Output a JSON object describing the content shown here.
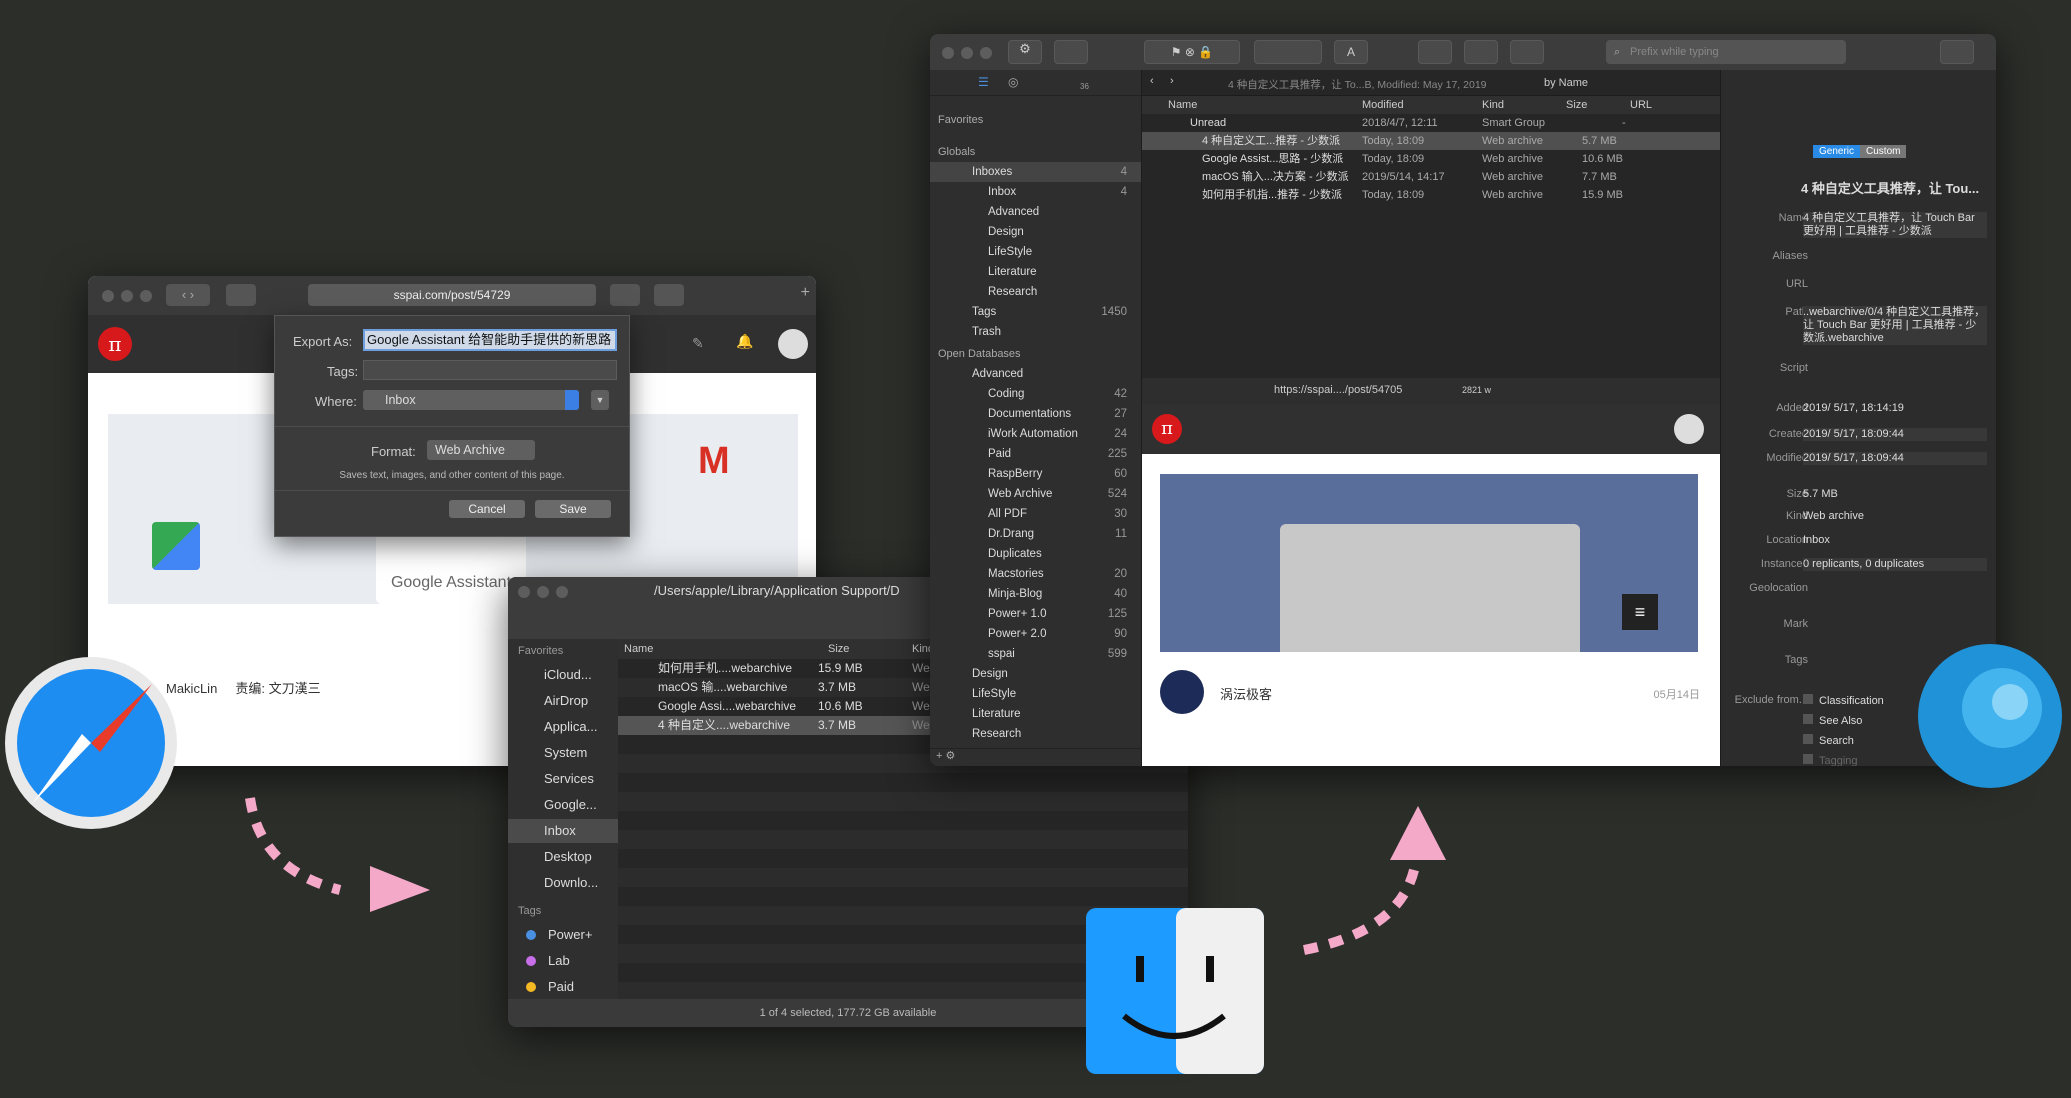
{
  "safari": {
    "url": "sspai.com/post/54729",
    "author": "MakicLin",
    "editor": "责编: 文刀漢三",
    "card": "Google Assistant"
  },
  "export": {
    "export_label": "Export As:",
    "export_value": "Google Assistant 给智能助手提供的新思路",
    "tags_label": "Tags:",
    "where_label": "Where:",
    "where_value": "Inbox",
    "format_label": "Format:",
    "format_value": "Web Archive",
    "desc": "Saves text, images, and other content of this page.",
    "cancel": "Cancel",
    "save": "Save"
  },
  "finder": {
    "path": "/Users/apple/Library/Application Support/D",
    "favorites_header": "Favorites",
    "favorites": [
      "iCloud...",
      "AirDrop",
      "Applica...",
      "System",
      "Services",
      "Google...",
      "Inbox",
      "Desktop",
      "Downlo..."
    ],
    "tags_header": "Tags",
    "tags": [
      {
        "name": "Power+",
        "color": "#4a90e2"
      },
      {
        "name": "Lab",
        "color": "#c86ee8"
      },
      {
        "name": "Paid",
        "color": "#f5b923"
      }
    ],
    "cols": {
      "name": "Name",
      "size": "Size",
      "kind": "Kind"
    },
    "files": [
      {
        "name": "如何用手机....webarchive",
        "size": "15.9 MB",
        "kind": "Web"
      },
      {
        "name": "macOS 输....webarchive",
        "size": "3.7 MB",
        "kind": "Web"
      },
      {
        "name": "Google Assi....webarchive",
        "size": "10.6 MB",
        "kind": "Web"
      },
      {
        "name": "4 种自定义....webarchive",
        "size": "3.7 MB",
        "kind": "Web"
      }
    ],
    "status": "1 of 4 selected, 177.72 GB available"
  },
  "devon": {
    "search_placeholder": "Prefix while typing",
    "crumb": "4 种自定义工具推荐，让 To...B, Modified: May 17, 2019",
    "sort": "by Name",
    "badge": "36",
    "sidebar": {
      "favorites": "Favorites",
      "globals": "Globals",
      "open_db": "Open Databases",
      "globals_items": [
        {
          "t": "Inboxes",
          "c": "4",
          "dot": true
        },
        {
          "t": "Inbox",
          "c": "4"
        },
        {
          "t": "Advanced",
          "c": ""
        },
        {
          "t": "Design",
          "c": ""
        },
        {
          "t": "LifeStyle",
          "c": ""
        },
        {
          "t": "Literature",
          "c": ""
        },
        {
          "t": "Research",
          "c": ""
        },
        {
          "t": "Tags",
          "c": "1450"
        },
        {
          "t": "Trash",
          "c": ""
        }
      ],
      "db_items": [
        {
          "t": "Advanced",
          "c": ""
        },
        {
          "t": "Coding",
          "c": "42"
        },
        {
          "t": "Documentations",
          "c": "27"
        },
        {
          "t": "iWork Automation",
          "c": "24"
        },
        {
          "t": "Paid",
          "c": "225"
        },
        {
          "t": "RaspBerry",
          "c": "60"
        },
        {
          "t": "Web Archive",
          "c": "524"
        },
        {
          "t": "All PDF",
          "c": "30"
        },
        {
          "t": "Dr.Drang",
          "c": "11"
        },
        {
          "t": "Duplicates",
          "c": ""
        },
        {
          "t": "Macstories",
          "c": "20"
        },
        {
          "t": "Minja-Blog",
          "c": "40"
        },
        {
          "t": "Power+ 1.0",
          "c": "125"
        },
        {
          "t": "Power+ 2.0",
          "c": "90"
        },
        {
          "t": "sspai",
          "c": "599"
        },
        {
          "t": "Design",
          "c": ""
        },
        {
          "t": "LifeStyle",
          "c": ""
        },
        {
          "t": "Literature",
          "c": ""
        },
        {
          "t": "Research",
          "c": ""
        }
      ]
    },
    "cols": {
      "name": "Name",
      "modified": "Modified",
      "kind": "Kind",
      "size": "Size",
      "url": "URL"
    },
    "group": {
      "name": "Unread",
      "modified": "2018/4/7, 12:11",
      "kind": "Smart Group",
      "size": "-"
    },
    "records": [
      {
        "name": "4 种自定义工...推荐 - 少数派",
        "modified": "Today, 18:09",
        "kind": "Web archive",
        "size": "5.7 MB"
      },
      {
        "name": "Google Assist...思路 - 少数派",
        "modified": "Today, 18:09",
        "kind": "Web archive",
        "size": "10.6 MB"
      },
      {
        "name": "macOS 输入...决方案 - 少数派",
        "modified": "2019/5/14, 14:17",
        "kind": "Web archive",
        "size": "7.7 MB"
      },
      {
        "name": "如何用手机指...推荐 - 少数派",
        "modified": "Today, 18:09",
        "kind": "Web archive",
        "size": "15.9 MB"
      }
    ],
    "viewer": {
      "url": "https://sspai..../post/54705",
      "words": "2821 w",
      "author": "涡沄极客",
      "date": "05月14日"
    },
    "inspector": {
      "tabs": [
        "Generic",
        "Custom"
      ],
      "title": "4 种自定义工具推荐，让 Tou...",
      "name_label": "Name",
      "name": "4 种自定义工具推荐，让 Touch Bar 更好用 | 工具推荐 - 少数派",
      "aliases": "Aliases",
      "url": "URL",
      "path_label": "Path",
      "path": "..webarchive/0/4 种自定义工具推荐，让 Touch Bar 更好用 | 工具推荐 - 少数派.webarchive",
      "script": "Script",
      "added_label": "Added",
      "added": "2019/  5/17, 18:14:19",
      "created_label": "Created",
      "created": "2019/  5/17, 18:09:44",
      "modified_label": "Modified",
      "modified": "2019/  5/17, 18:09:44",
      "size_label": "Size",
      "size": "5.7 MB",
      "kind_label": "Kind",
      "kind": "Web archive",
      "location_label": "Location",
      "location": "Inbox",
      "instances_label": "Instances",
      "instances": "0 replicants, 0 duplicates",
      "geo": "Geolocation",
      "mark": "Mark",
      "tags": "Tags",
      "exclude": "Exclude from...",
      "ex_items": [
        "Classification",
        "See Also",
        "Search",
        "Tagging"
      ]
    }
  }
}
